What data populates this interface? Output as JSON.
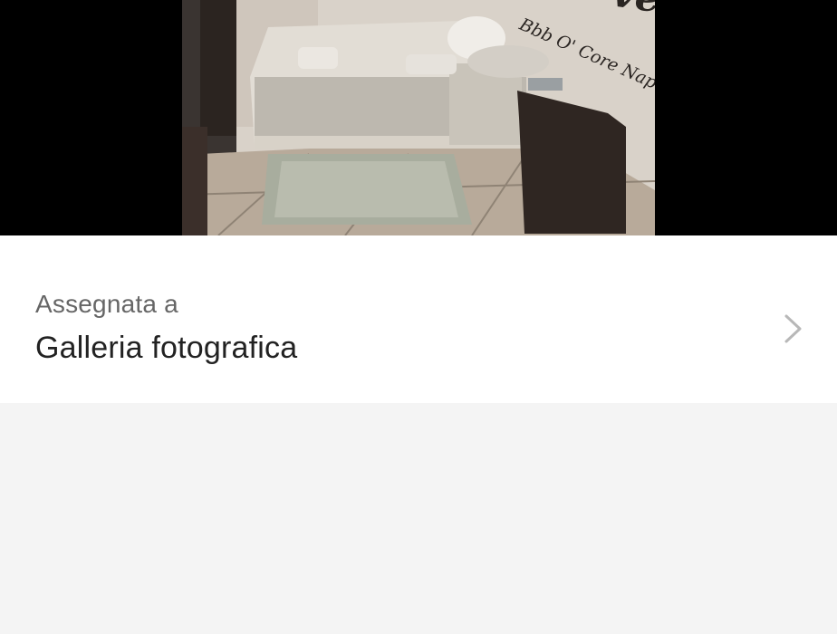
{
  "photo": {
    "alt": "Room photo with bed and wall lettering",
    "wall_text_large": "ve",
    "wall_text_small": "Bbb O' Core Nap"
  },
  "assignment": {
    "caption": "Assegnata a",
    "value": "Galleria fotografica",
    "icon": "chevron-right-icon"
  },
  "colors": {
    "photo_letterbox": "#000000",
    "row_background": "#ffffff",
    "page_background": "#f4f4f4",
    "caption_text": "#666666",
    "value_text": "#222222",
    "chevron": "#b8b8b8"
  }
}
